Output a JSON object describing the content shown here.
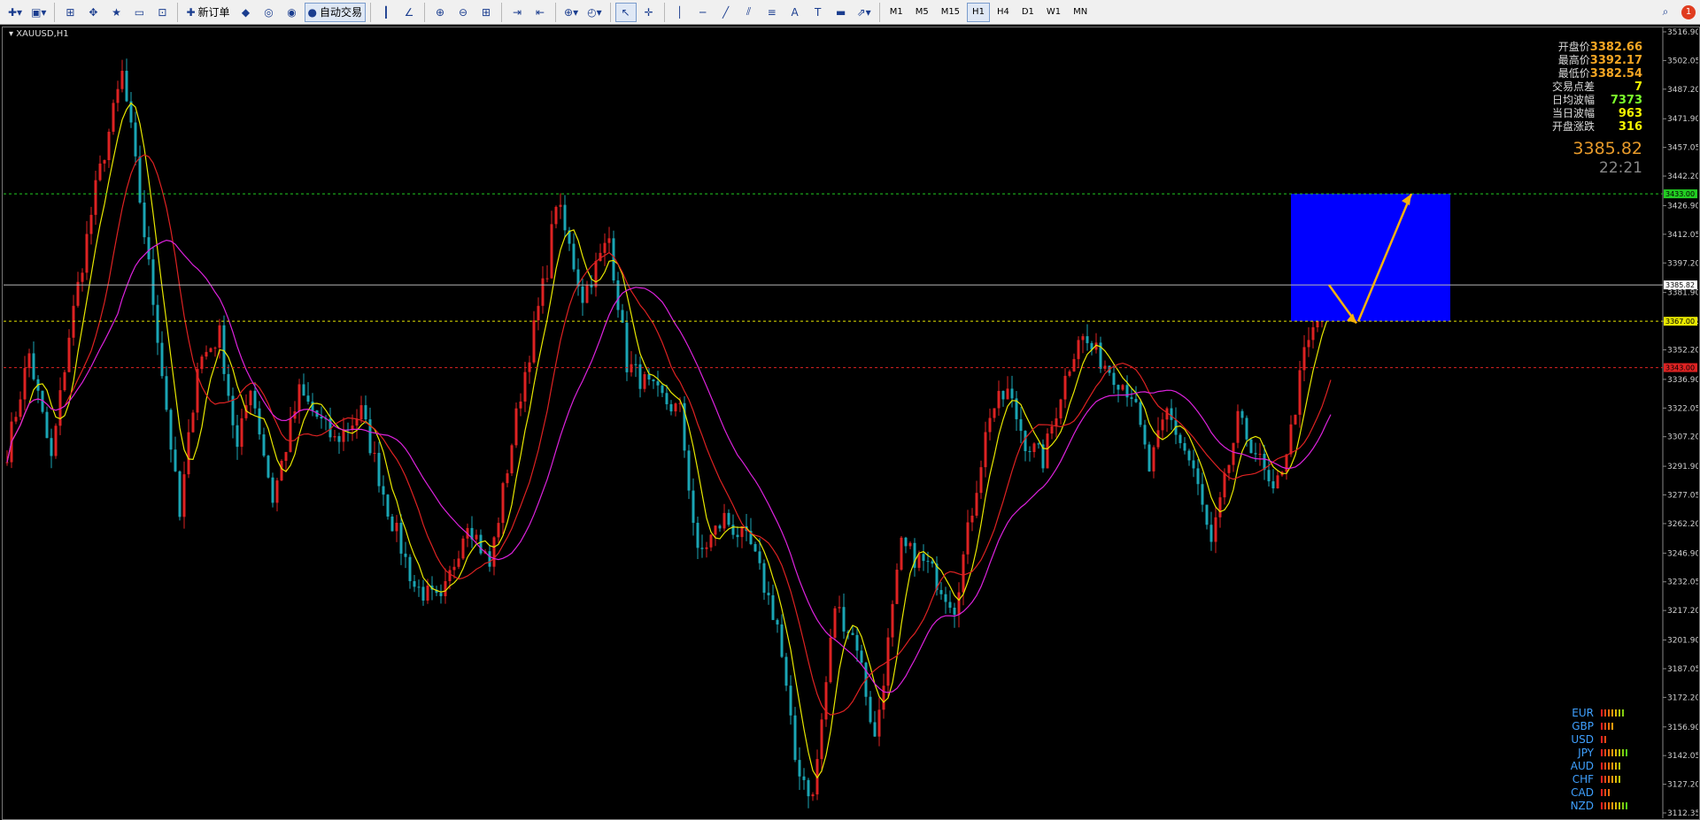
{
  "toolbar": {
    "new_order_label": "新订单",
    "auto_trade_label": "自动交易",
    "timeframes": [
      "M1",
      "M5",
      "M15",
      "H1",
      "H4",
      "D1",
      "W1",
      "MN"
    ],
    "active_timeframe": "H1",
    "notification_badge": "1"
  },
  "chart": {
    "symbol_title": "XAUUSD,H1",
    "axis_ticks": [
      "3516.90",
      "3502.05",
      "3487.20",
      "3471.90",
      "3457.05",
      "3442.20",
      "3426.90",
      "3412.05",
      "3397.20",
      "3381.90",
      "3367.05",
      "3352.20",
      "3336.90",
      "3322.05",
      "3307.20",
      "3291.90",
      "3277.05",
      "3262.20",
      "3246.90",
      "3232.05",
      "3217.20",
      "3201.90",
      "3187.05",
      "3172.20",
      "3156.90",
      "3142.05",
      "3127.20",
      "3112.35"
    ],
    "levels": [
      {
        "price": 3433.0,
        "label": "3433.00",
        "color": "#22cc22"
      },
      {
        "price": 3385.82,
        "label": "3385.82",
        "color": "#b8b8b8"
      },
      {
        "price": 3367.0,
        "label": "3367.00",
        "color": "#e8e800"
      },
      {
        "price": 3343.0,
        "label": "3343.00",
        "color": "#dd2222"
      }
    ],
    "colors": {
      "up": "#dd2222",
      "down": "#1aa5b4",
      "ma_fast": "#e8e800",
      "ma_mid": "#dd2222",
      "ma_slow": "#dd22dd",
      "zone": "#0000ff",
      "arrow": "#f5b20c"
    }
  },
  "info_panel": [
    {
      "label": "开盘价",
      "value": "3382.66",
      "color": "#f5a623"
    },
    {
      "label": "最高价",
      "value": "3392.17",
      "color": "#f5a623"
    },
    {
      "label": "最低价",
      "value": "3382.54",
      "color": "#f5a623"
    },
    {
      "label": "交易点差",
      "value": "7",
      "color": "#f5f500"
    },
    {
      "label": "日均波幅",
      "value": "7373",
      "color": "#7cff2b"
    },
    {
      "label": "当日波幅",
      "value": "963",
      "color": "#f5f500"
    },
    {
      "label": "开盘涨跌",
      "value": "316",
      "color": "#f5f500"
    }
  ],
  "big_price": "3385.82",
  "big_time": "22:21",
  "currencies": [
    {
      "name": "EUR",
      "strength": 7
    },
    {
      "name": "GBP",
      "strength": 4
    },
    {
      "name": "USD",
      "strength": 2
    },
    {
      "name": "JPY",
      "strength": 8
    },
    {
      "name": "AUD",
      "strength": 6
    },
    {
      "name": "CHF",
      "strength": 6
    },
    {
      "name": "CAD",
      "strength": 3
    },
    {
      "name": "NZD",
      "strength": 8
    }
  ]
}
